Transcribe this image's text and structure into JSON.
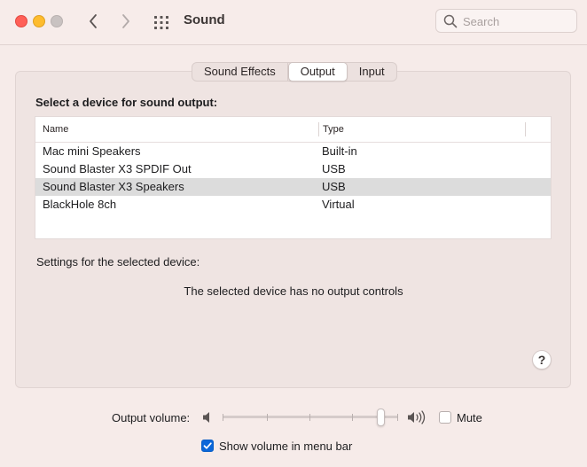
{
  "window": {
    "title": "Sound",
    "search": {
      "placeholder": "Search",
      "value": ""
    }
  },
  "tabs": [
    {
      "label": "Sound Effects",
      "active": false
    },
    {
      "label": "Output",
      "active": true
    },
    {
      "label": "Input",
      "active": false
    }
  ],
  "output": {
    "heading": "Select a device for sound output:",
    "columns": {
      "name": "Name",
      "type": "Type"
    },
    "devices": [
      {
        "name": "Mac mini Speakers",
        "type": "Built-in",
        "selected": false
      },
      {
        "name": "Sound Blaster X3 SPDIF Out",
        "type": "USB",
        "selected": false
      },
      {
        "name": "Sound Blaster X3 Speakers",
        "type": "USB",
        "selected": true
      },
      {
        "name": "BlackHole 8ch",
        "type": "Virtual",
        "selected": false
      }
    ],
    "settings_label": "Settings for the selected device:",
    "no_controls_message": "The selected device has no output controls",
    "help_label": "?"
  },
  "volume": {
    "label": "Output volume:",
    "level": 0.9,
    "mute_label": "Mute",
    "mute_checked": false,
    "show_in_menu_bar_label": "Show volume in menu bar",
    "show_in_menu_bar_checked": true
  },
  "icons": {
    "close": "close-icon",
    "minimize": "minimize-icon",
    "zoom": "zoom-icon",
    "back": "chevron-left-icon",
    "forward": "chevron-right-icon",
    "show_all": "grid-icon",
    "search": "search-icon",
    "volume_low": "speaker-low-icon",
    "volume_high": "speaker-high-icon",
    "checkmark": "checkmark-icon"
  },
  "colors": {
    "accent": "#0a67d9",
    "close": "#ff5f57",
    "minimize": "#febc2e",
    "zoom_disabled": "#c9c2c1",
    "background": "#f6ebe9",
    "selected_row": "#dcdcdc"
  }
}
